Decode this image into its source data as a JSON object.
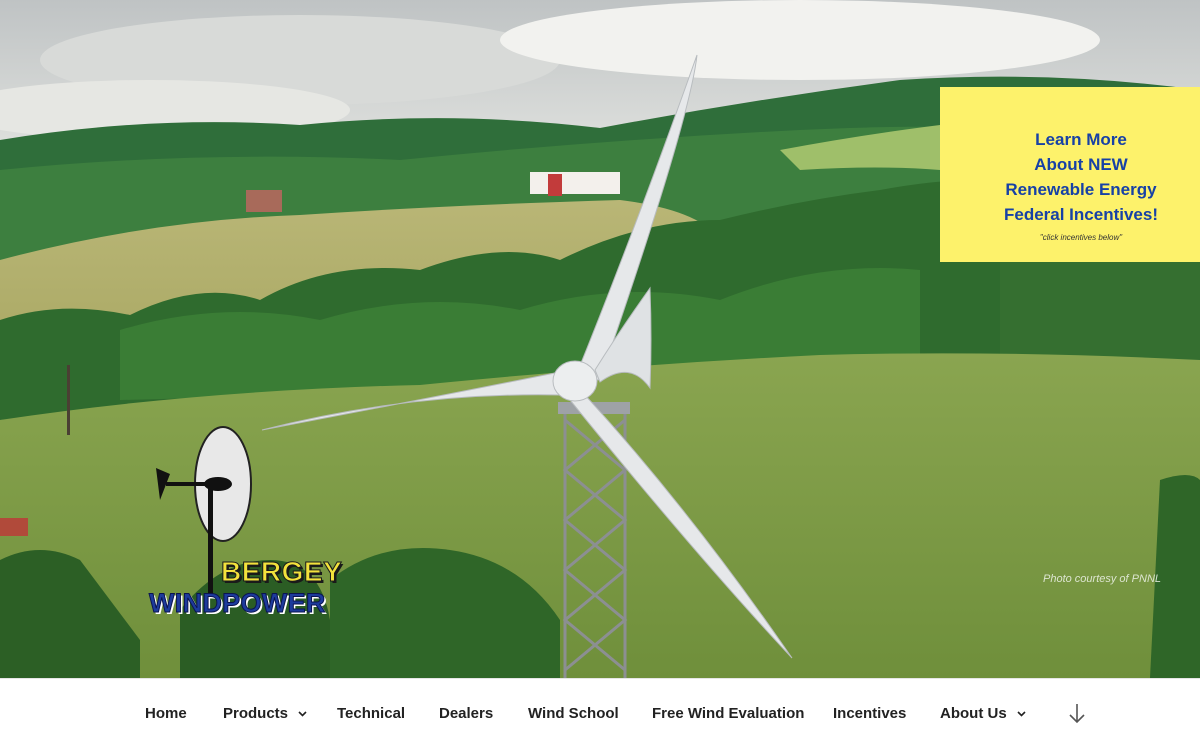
{
  "promo": {
    "line1": "Learn More",
    "line2": "About NEW",
    "line3": "Renewable Energy",
    "line4": "Federal Incentives!",
    "sub": "\"click incentives below\""
  },
  "hero": {
    "photo_credit": "Photo courtesy of PNNL"
  },
  "logo": {
    "line1": "BERGEY",
    "line2": "WINDPOWER"
  },
  "nav": {
    "items": [
      {
        "label": "Home",
        "has_dropdown": false
      },
      {
        "label": "Products",
        "has_dropdown": true
      },
      {
        "label": "Technical",
        "has_dropdown": false
      },
      {
        "label": "Dealers",
        "has_dropdown": false
      },
      {
        "label": "Wind School",
        "has_dropdown": false
      },
      {
        "label": "Free Wind Evaluation",
        "has_dropdown": false
      },
      {
        "label": "Incentives",
        "has_dropdown": false
      },
      {
        "label": "About Us",
        "has_dropdown": true
      }
    ],
    "scroll_icon": "arrow-down-icon"
  },
  "colors": {
    "promo_bg": "#fdf26b",
    "promo_text": "#1741a6",
    "logo_yellow": "#f3e23c",
    "logo_blue": "#1d3b9c",
    "nav_text": "#222222"
  }
}
